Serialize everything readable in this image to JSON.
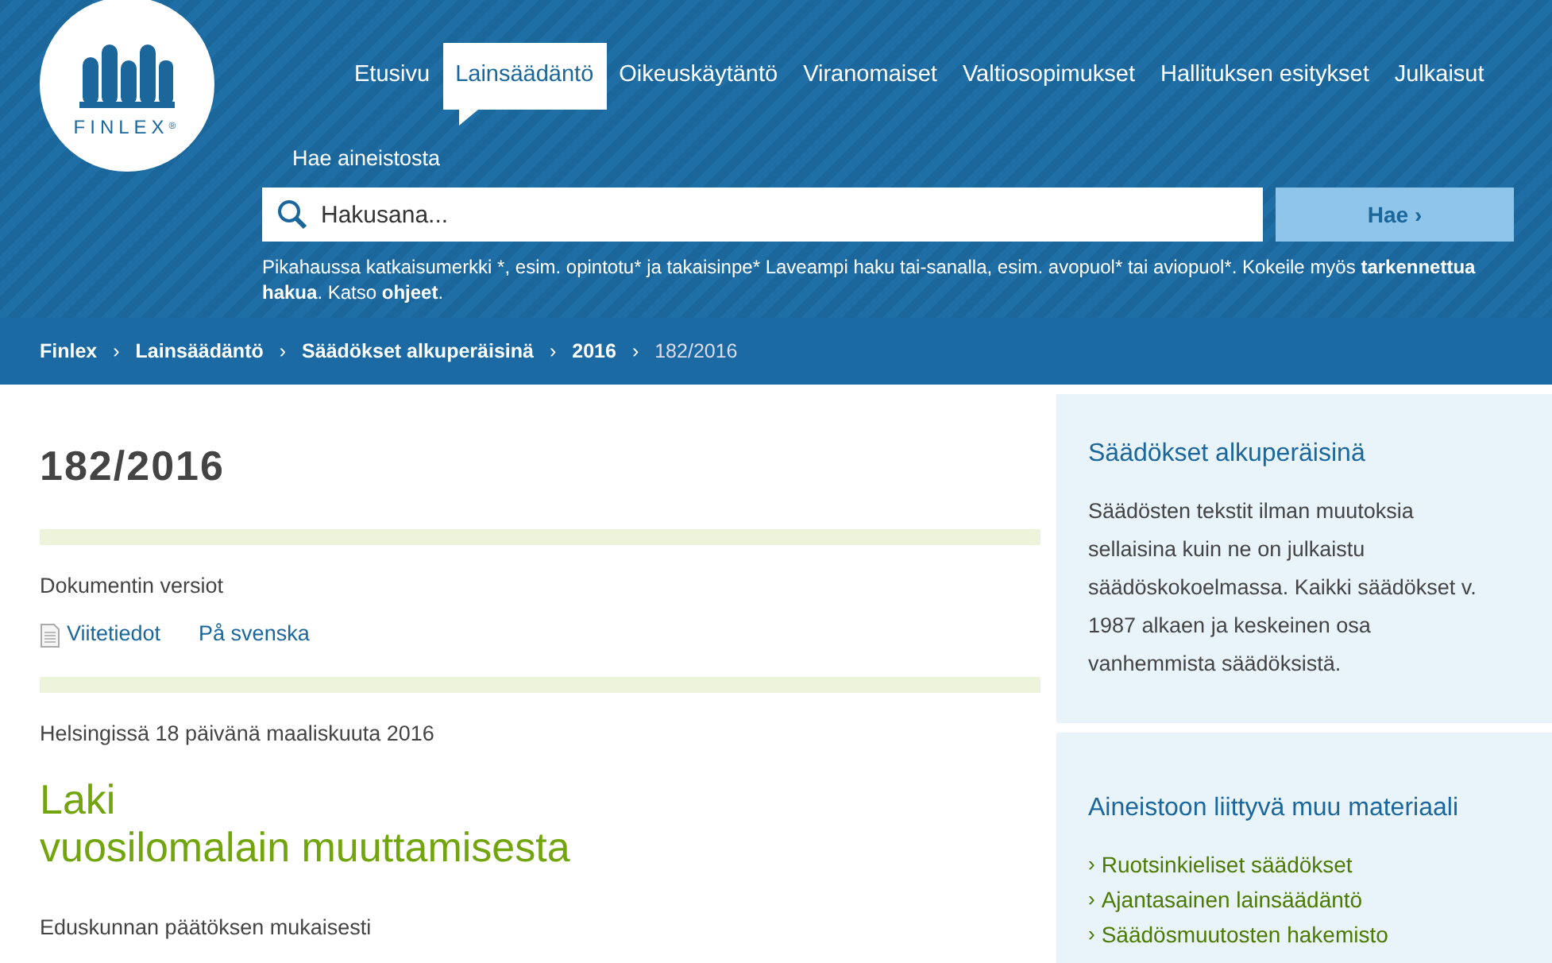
{
  "logo": {
    "text": "FINLEX",
    "mark": "®"
  },
  "nav": [
    {
      "label": "Etusivu",
      "selected": false
    },
    {
      "label": "Lainsäädäntö",
      "selected": true
    },
    {
      "label": "Oikeuskäytäntö",
      "selected": false
    },
    {
      "label": "Viranomaiset",
      "selected": false
    },
    {
      "label": "Valtiosopimukset",
      "selected": false
    },
    {
      "label": "Hallituksen esitykset",
      "selected": false
    },
    {
      "label": "Julkaisut",
      "selected": false
    }
  ],
  "search": {
    "label": "Hae aineistosta",
    "placeholder": "Hakusana...",
    "button": "Hae ›",
    "help": [
      {
        "text": "Pikahaussa katkaisumerkki *, esim. opintotu* ja takaisinpe* Laveampi haku tai-sanalla, esim. avopuol* tai aviopuol*. Kokeile myös ",
        "bold": false
      },
      {
        "text": "tarkennettua hakua",
        "bold": true
      },
      {
        "text": ". Katso ",
        "bold": false
      },
      {
        "text": "ohjeet",
        "bold": true
      },
      {
        "text": ".",
        "bold": false
      }
    ]
  },
  "breadcrumb_separator": "›",
  "breadcrumb": [
    "Finlex",
    "Lainsäädäntö",
    "Säädökset alkuperäisinä",
    "2016",
    "182/2016"
  ],
  "document": {
    "number": "182/2016",
    "versions_label": "Dokumentin versiot",
    "version_links": [
      "Viitetiedot",
      "På svenska"
    ],
    "place_date": "Helsingissä 18 päivänä maaliskuuta 2016",
    "title_lines": [
      "Laki",
      "vuosilomalain muuttamisesta"
    ],
    "preamble": "Eduskunnan päätöksen mukaisesti"
  },
  "sidebar": [
    {
      "title": "Säädökset alkuperäisinä",
      "text": "Säädösten tekstit ilman muutoksia sellaisina kuin ne on julkaistu säädöskokoelmassa. Kaikki säädökset v. 1987 alkaen ja keskeinen osa vanhemmista säädöksistä."
    },
    {
      "title": "Aineistoon liittyvä muu materiaali",
      "bullet": "›",
      "links": [
        "Ruotsinkieliset säädökset",
        "Ajantasainen lainsäädäntö",
        "Säädösmuutosten hakemisto"
      ]
    }
  ]
}
